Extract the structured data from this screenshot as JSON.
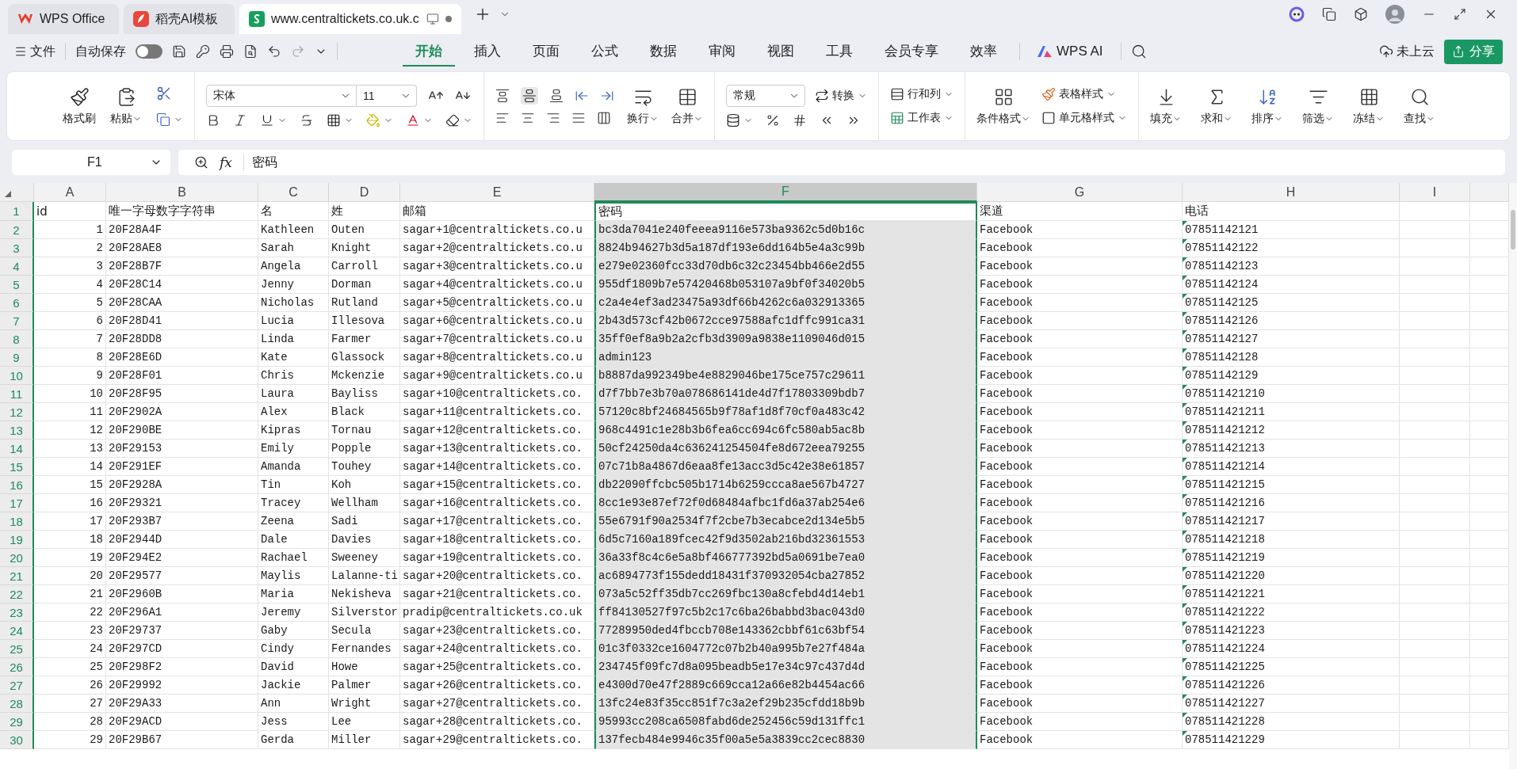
{
  "tabs": [
    {
      "label": "WPS Office",
      "kind": "wps",
      "selected": false
    },
    {
      "label": "稻壳AI模板",
      "kind": "docer",
      "selected": false
    },
    {
      "label": "www.centraltickets.co.uk.c",
      "kind": "sheet",
      "selected": true,
      "unsaved": true
    }
  ],
  "menu": {
    "file": "文件",
    "autosave": {
      "label": "自动保存",
      "on": false
    },
    "quick_access": [
      {
        "kind": "save",
        "disabled": false
      },
      {
        "kind": "key",
        "disabled": false
      },
      {
        "kind": "print",
        "disabled": false
      },
      {
        "kind": "preview",
        "disabled": false
      },
      {
        "kind": "undo",
        "disabled": false
      },
      {
        "kind": "redo",
        "disabled": true
      }
    ],
    "ribbon_tabs": [
      {
        "label": "开始",
        "selected": true
      },
      {
        "label": "插入",
        "selected": false
      },
      {
        "label": "页面",
        "selected": false
      },
      {
        "label": "公式",
        "selected": false
      },
      {
        "label": "数据",
        "selected": false
      },
      {
        "label": "审阅",
        "selected": false
      },
      {
        "label": "视图",
        "selected": false
      },
      {
        "label": "工具",
        "selected": false
      },
      {
        "label": "会员专享",
        "selected": false
      },
      {
        "label": "效率",
        "selected": false
      }
    ],
    "ai": "WPS AI",
    "cloud": "未上云",
    "share": "分享"
  },
  "ribbon": {
    "format_painter": "格式刷",
    "paste": "粘贴",
    "font_name": "宋体",
    "font_size": "11",
    "wrap": "换行",
    "merge": "合并",
    "number_format": "常规",
    "convert": "转换",
    "rows_cols": "行和列",
    "worksheet": "工作表",
    "conditional": "条件格式",
    "table_style": "表格样式",
    "cell_style": "单元格样式",
    "editing": [
      {
        "kind": "fill",
        "label": "填充"
      },
      {
        "kind": "sum",
        "label": "求和"
      },
      {
        "kind": "sort",
        "label": "排序"
      },
      {
        "kind": "filter",
        "label": "筛选"
      },
      {
        "kind": "freeze",
        "label": "冻结"
      },
      {
        "kind": "find",
        "label": "查找"
      }
    ]
  },
  "formula_bar": {
    "name_box": "F1",
    "fx": "fx",
    "formula": "密码"
  },
  "sheet": {
    "columns": [
      {
        "label": "A",
        "selected": false
      },
      {
        "label": "B",
        "selected": false
      },
      {
        "label": "C",
        "selected": false
      },
      {
        "label": "D",
        "selected": false
      },
      {
        "label": "E",
        "selected": false
      },
      {
        "label": "F",
        "selected": true
      },
      {
        "label": "G",
        "selected": false
      },
      {
        "label": "H",
        "number_stored_as_text": true,
        "selected": false
      },
      {
        "label": "I",
        "selected": false
      }
    ],
    "header_row": {
      "number": "1",
      "cells": [
        "id",
        "唯一字母数字字符串",
        "名",
        "姓",
        "邮箱",
        "密码",
        "渠道",
        "电话"
      ]
    },
    "rows": [
      {
        "number": "2",
        "cells": [
          "1",
          "20F28A4F",
          "Kathleen",
          "Outen",
          "sagar+1@centraltickets.co.u",
          "bc3da7041e240feeea9116e573ba9362c5d0b16c",
          "Facebook",
          "07851142121"
        ]
      },
      {
        "number": "3",
        "cells": [
          "2",
          "20F28AE8",
          "Sarah",
          "Knight",
          "sagar+2@centraltickets.co.u",
          "8824b94627b3d5a187df193e6dd164b5e4a3c99b",
          "Facebook",
          "07851142122"
        ]
      },
      {
        "number": "4",
        "cells": [
          "3",
          "20F28B7F",
          "Angela",
          "Carroll",
          "sagar+3@centraltickets.co.u",
          "e279e02360fcc33d70db6c32c23454bb466e2d55",
          "Facebook",
          "07851142123"
        ]
      },
      {
        "number": "5",
        "cells": [
          "4",
          "20F28C14",
          "Jenny",
          "Dorman",
          "sagar+4@centraltickets.co.u",
          "955df1809b7e57420468b053107a9bf0f34020b5",
          "Facebook",
          "07851142124"
        ]
      },
      {
        "number": "6",
        "cells": [
          "5",
          "20F28CAA",
          "Nicholas",
          "Rutland",
          "sagar+5@centraltickets.co.u",
          "c2a4e4ef3ad23475a93df66b4262c6a032913365",
          "Facebook",
          "07851142125"
        ]
      },
      {
        "number": "7",
        "cells": [
          "6",
          "20F28D41",
          "Lucia",
          "Illesova",
          "sagar+6@centraltickets.co.u",
          "2b43d573cf42b0672cce97588afc1dffc991ca31",
          "Facebook",
          "07851142126"
        ]
      },
      {
        "number": "8",
        "cells": [
          "7",
          "20F28DD8",
          "Linda",
          "Farmer",
          "sagar+7@centraltickets.co.u",
          "35ff0ef8a9b2a2cfb3d3909a9838e1109046d015",
          "Facebook",
          "07851142127"
        ]
      },
      {
        "number": "9",
        "cells": [
          "8",
          "20F28E6D",
          "Kate",
          "Glassock",
          "sagar+8@centraltickets.co.u",
          "admin123",
          "Facebook",
          "07851142128"
        ]
      },
      {
        "number": "10",
        "cells": [
          "9",
          "20F28F01",
          "Chris",
          "Mckenzie",
          "sagar+9@centraltickets.co.u",
          "b8887da992349be4e8829046be175ce757c29611",
          "Facebook",
          "07851142129"
        ]
      },
      {
        "number": "11",
        "cells": [
          "10",
          "20F28F95",
          "Laura",
          "Bayliss",
          "sagar+10@centraltickets.co.",
          "d7f7bb7e3b70a078686141de4d7f17803309bdb7",
          "Facebook",
          "078511421210"
        ]
      },
      {
        "number": "12",
        "cells": [
          "11",
          "20F2902A",
          "Alex",
          "Black",
          "sagar+11@centraltickets.co.",
          "57120c8bf24684565b9f78af1d8f70cf0a483c42",
          "Facebook",
          "078511421211"
        ]
      },
      {
        "number": "13",
        "cells": [
          "12",
          "20F290BE",
          "Kipras",
          "Tornau",
          "sagar+12@centraltickets.co.",
          "968c4491c1e28b3b6fea6cc694c6fc580ab5ac8b",
          "Facebook",
          "078511421212"
        ]
      },
      {
        "number": "14",
        "cells": [
          "13",
          "20F29153",
          "Emily",
          "Popple",
          "sagar+13@centraltickets.co.",
          "50cf24250da4c636241254504fe8d672eea79255",
          "Facebook",
          "078511421213"
        ]
      },
      {
        "number": "15",
        "cells": [
          "14",
          "20F291EF",
          "Amanda",
          "Touhey",
          "sagar+14@centraltickets.co.",
          "07c71b8a4867d6eaa8fe13acc3d5c42e38e61857",
          "Facebook",
          "078511421214"
        ]
      },
      {
        "number": "16",
        "cells": [
          "15",
          "20F2928A",
          "Tin",
          "Koh",
          "sagar+15@centraltickets.co.",
          "db22090ffcbc505b1714b6259ccca8ae567b4727",
          "Facebook",
          "078511421215"
        ]
      },
      {
        "number": "17",
        "cells": [
          "16",
          "20F29321",
          "Tracey",
          "Wellham",
          "sagar+16@centraltickets.co.",
          "8cc1e93e87ef72f0d68484afbc1fd6a37ab254e6",
          "Facebook",
          "078511421216"
        ]
      },
      {
        "number": "18",
        "cells": [
          "17",
          "20F293B7",
          "Zeena",
          "Sadi",
          "sagar+17@centraltickets.co.",
          "55e6791f90a2534f7f2cbe7b3ecabce2d134e5b5",
          "Facebook",
          "078511421217"
        ]
      },
      {
        "number": "19",
        "cells": [
          "18",
          "20F2944D",
          "Dale",
          "Davies",
          "sagar+18@centraltickets.co.",
          "6d5c7160a189fcec42f9d3502ab216bd32361553",
          "Facebook",
          "078511421218"
        ]
      },
      {
        "number": "20",
        "cells": [
          "19",
          "20F294E2",
          "Rachael",
          "Sweeney",
          "sagar+19@centraltickets.co.",
          "36a33f8c4c6e5a8bf466777392bd5a0691be7ea0",
          "Facebook",
          "078511421219"
        ]
      },
      {
        "number": "21",
        "cells": [
          "20",
          "20F29577",
          "Maylis",
          "Lalanne-ti",
          "sagar+20@centraltickets.co.",
          "ac6894773f155dedd18431f370932054cba27852",
          "Facebook",
          "078511421220"
        ]
      },
      {
        "number": "22",
        "cells": [
          "21",
          "20F2960B",
          "Maria",
          "Nekisheva",
          "sagar+21@centraltickets.co.",
          "073a5c52ff35db7cc269fbc130a8cfebd4d14eb1",
          "Facebook",
          "078511421221"
        ]
      },
      {
        "number": "23",
        "cells": [
          "22",
          "20F296A1",
          "Jeremy",
          "Silverstor",
          "pradip@centraltickets.co.uk",
          "ff84130527f97c5b2c17c6ba26babbd3bac043d0",
          "Facebook",
          "078511421222"
        ]
      },
      {
        "number": "24",
        "cells": [
          "23",
          "20F29737",
          "Gaby",
          "Secula",
          "sagar+23@centraltickets.co.",
          "77289950ded4fbccb708e143362cbbf61c63bf54",
          "Facebook",
          "078511421223"
        ]
      },
      {
        "number": "25",
        "cells": [
          "24",
          "20F297CD",
          "Cindy",
          "Fernandes",
          "sagar+24@centraltickets.co.",
          "01c3f0332ce1604772c07b2b40a995b7e27f484a",
          "Facebook",
          "078511421224"
        ]
      },
      {
        "number": "26",
        "cells": [
          "25",
          "20F298F2",
          "David",
          "Howe",
          "sagar+25@centraltickets.co.",
          "234745f09fc7d8a095beadb5e17e34c97c437d4d",
          "Facebook",
          "078511421225"
        ]
      },
      {
        "number": "27",
        "cells": [
          "26",
          "20F29992",
          "Jackie",
          "Palmer",
          "sagar+26@centraltickets.co.",
          "e4300d70e47f2889c669cca12a66e82b4454ac66",
          "Facebook",
          "078511421226"
        ]
      },
      {
        "number": "28",
        "cells": [
          "27",
          "20F29A33",
          "Ann",
          "Wright",
          "sagar+27@centraltickets.co.",
          "13fc24e83f35cc851f7c3a2ef29b235cfdd18b9b",
          "Facebook",
          "078511421227"
        ]
      },
      {
        "number": "29",
        "cells": [
          "28",
          "20F29ACD",
          "Jess",
          "Lee",
          "sagar+28@centraltickets.co.",
          "95993cc208ca6508fabd6de252456c59d131ffc1",
          "Facebook",
          "078511421228"
        ]
      },
      {
        "number": "30",
        "cells": [
          "29",
          "20F29B67",
          "Gerda",
          "Miller",
          "sagar+29@centraltickets.co.",
          "137fecb484e9946c35f00a5e5a3839cc2cec8830",
          "Facebook",
          "078511421229"
        ]
      }
    ]
  }
}
